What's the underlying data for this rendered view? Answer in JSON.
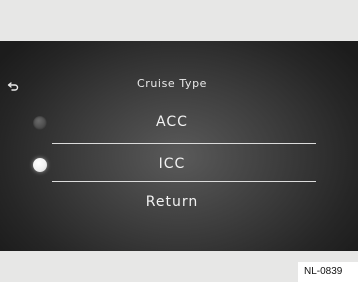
{
  "header": {
    "title": "Cruise Type"
  },
  "icons": {
    "back": "back-arrow-icon"
  },
  "menu": {
    "options": [
      {
        "label": "ACC",
        "selected": false
      },
      {
        "label": "ICC",
        "selected": true
      },
      {
        "label": "Return",
        "selected": null
      }
    ]
  },
  "figure_ref": "NL-0839",
  "colors": {
    "screen_background": "#2a2a2a",
    "text": "#f2f2f2",
    "frame": "#e7e7e6",
    "divider": "#dcdcdc"
  }
}
